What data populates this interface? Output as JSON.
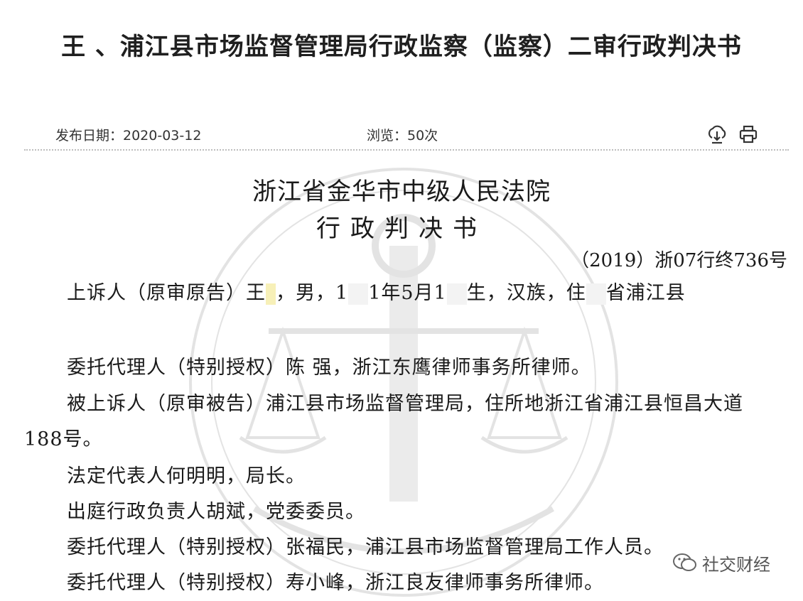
{
  "page_title": "王 、浦江县市场监督管理局行政监察（监察）二审行政判决书",
  "meta": {
    "publish_date": "发布日期：2020-03-12",
    "views": "浏览：50次",
    "icons": [
      "download-icon",
      "print-icon"
    ]
  },
  "document": {
    "court_name": "浙江省金华市中级人民法院",
    "doc_type": "行政判决书",
    "case_number": "（2019）浙07行终736号",
    "paragraphs": {
      "p1a": "上诉人（原审原告）王",
      "p1b": "，男，1",
      "p1c": "1年5月1",
      "p1d": "生，汉族，住",
      "p1e": "省浦江县",
      "p2": "委托代理人（特别授权）陈 强，浙江东鹰律师事务所律师。",
      "p3": "被上诉人（原审被告）浦江县市场监督管理局，住所地浙江省浦江县恒昌大道188号。",
      "p4": "法定代表人何明明，局长。",
      "p5": "出庭行政负责人胡斌，党委委员。",
      "p6": "委托代理人（特别授权）张福民，浦江县市场监督管理局工作人员。",
      "p7": "委托代理人（特别授权）寿小峰，浙江良友律师事务所律师。"
    }
  },
  "watermark_text": "社交财经",
  "colors": {
    "text": "#1a1a1a",
    "meta": "#333333",
    "divider": "#bdbdbd"
  }
}
